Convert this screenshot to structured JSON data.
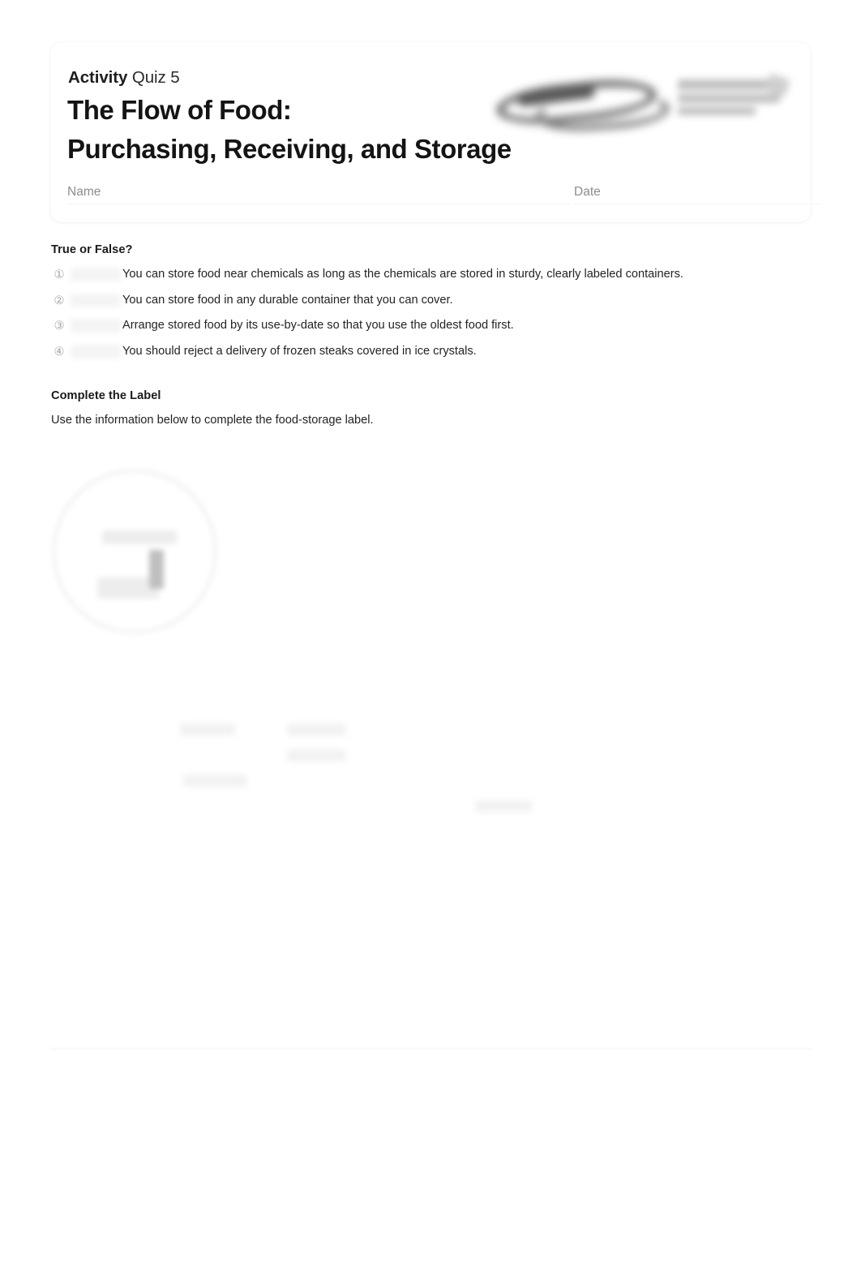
{
  "document": {
    "eyebrow_strong": "Activity",
    "eyebrow_light": "Quiz 5",
    "title_line_1": "The Flow of Food:",
    "title_line_2": "Purchasing, Receiving, and Storage",
    "name_label": "Name",
    "date_label": "Date",
    "name_value": "",
    "date_value": ""
  },
  "true_or_false": {
    "heading": "True or False?",
    "questions": [
      {
        "number": "①",
        "answer": "",
        "text": "You can store food near chemicals as long as the chemicals are stored in sturdy, clearly labeled containers."
      },
      {
        "number": "②",
        "answer": "",
        "text": "You can store food in any durable container that you can cover."
      },
      {
        "number": "③",
        "answer": "",
        "text": "Arrange stored food by its use-by-date so that you use the oldest food first."
      },
      {
        "number": "④",
        "answer": "",
        "text": "You should reject a delivery of frozen steaks covered in ice crystals."
      }
    ]
  },
  "complete_the_label": {
    "heading": "Complete the Label",
    "instruction": "Use the information below to complete the food-storage label."
  },
  "colors": {
    "page_background": "#ffffff",
    "card_background": "#ffffff",
    "title_text": "#141414",
    "body_text": "#232323",
    "muted_text": "#8d8d8d",
    "number_text": "#a8a8a8",
    "redaction_fill": "#f1f1f1",
    "rule": "#f5f5f5"
  }
}
